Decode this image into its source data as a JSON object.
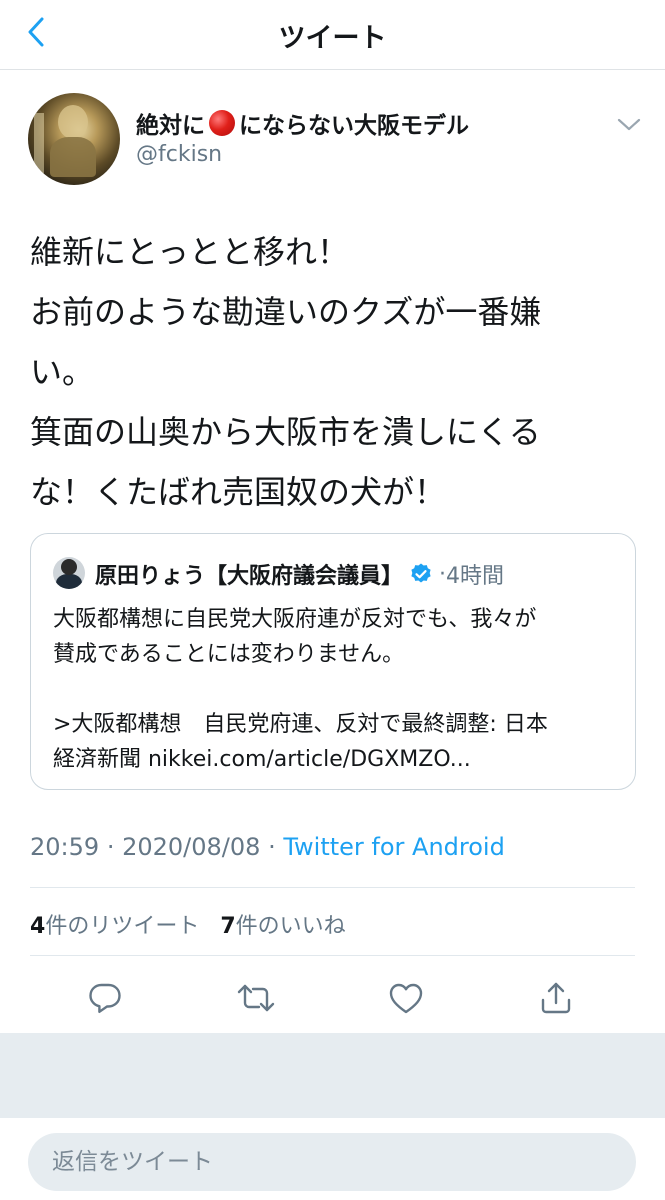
{
  "header": {
    "title": "ツイート",
    "back_icon": "chevron-left-icon",
    "accent_color": "#1da1f2"
  },
  "tweet": {
    "author": {
      "name_before": "絶対に",
      "name_emoji": "red-circle-icon",
      "name_after": "にならない大阪モデル",
      "handle": "@fckisn"
    },
    "text_lines": [
      "維新にとっとと移れ！",
      "お前のような勘違いのクズが一番嫌",
      "い。",
      "箕面の山奥から大阪市を潰しにくる",
      "な！くたばれ売国奴の犬が！"
    ],
    "quoted": {
      "name": "原田りょう【大阪府議会議員】",
      "verified_icon": "verified-badge-icon",
      "separator": "·",
      "time": "4時間",
      "line1": "大阪都構想に自民党大阪府連が反対でも、我々が",
      "line2": "賛成であることには変わりません。",
      "line3": ">大阪都構想　自民党府連、反対で最終調整: 日本",
      "line4": "経済新聞 nikkei.com/article/DGXMZO..."
    },
    "meta": {
      "time": "20:59",
      "sep1": "·",
      "date": "2020/08/08",
      "sep2": "·",
      "source": "Twitter for Android"
    },
    "stats": {
      "retweets_count": "4",
      "retweets_label": "件のリツイート",
      "likes_count": "7",
      "likes_label": "件のいいね"
    },
    "actions": [
      "reply-icon",
      "retweet-icon",
      "like-icon",
      "share-icon"
    ]
  },
  "reply": {
    "placeholder": "返信をツイート"
  }
}
